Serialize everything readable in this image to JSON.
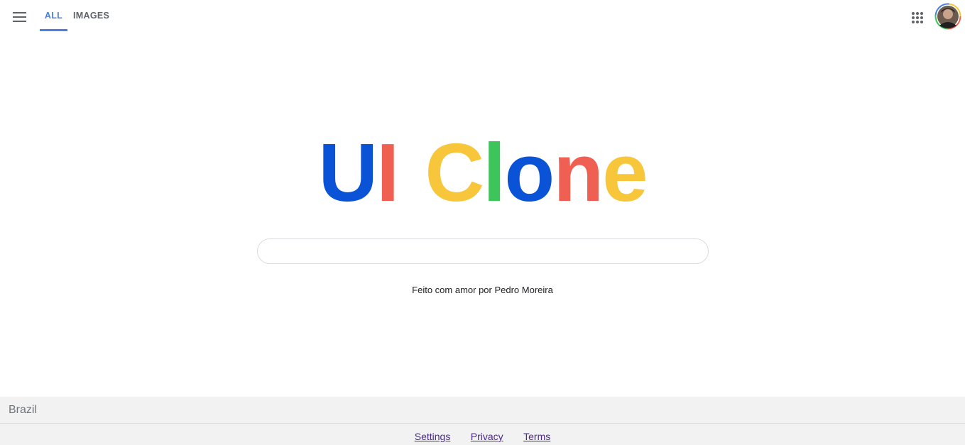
{
  "header": {
    "tabs": [
      {
        "label": "ALL",
        "active": true
      },
      {
        "label": "IMAGES",
        "active": false
      }
    ],
    "menu_icon": "hamburger-menu-icon",
    "apps_icon": "apps-grid-icon",
    "avatar": "user-avatar"
  },
  "logo": {
    "letters": [
      {
        "char": "U",
        "color": "#0a52d6"
      },
      {
        "char": "I",
        "color": "#f06052"
      },
      {
        "char": " ",
        "color": ""
      },
      {
        "char": "C",
        "color": "#f7c63b"
      },
      {
        "char": "l",
        "color": "#3dc45a"
      },
      {
        "char": "o",
        "color": "#0a52d6"
      },
      {
        "char": "n",
        "color": "#f06052"
      },
      {
        "char": "e",
        "color": "#f7c63b"
      }
    ]
  },
  "search": {
    "value": "",
    "placeholder": ""
  },
  "credit": "Feito com amor por Pedro Moreira",
  "footer": {
    "country": "Brazil",
    "links": [
      "Settings",
      "Privacy",
      "Terms"
    ]
  },
  "colors": {
    "accent": "#4a7fe0",
    "footer_bg": "#f2f2f2",
    "link": "#4b2a8a"
  }
}
